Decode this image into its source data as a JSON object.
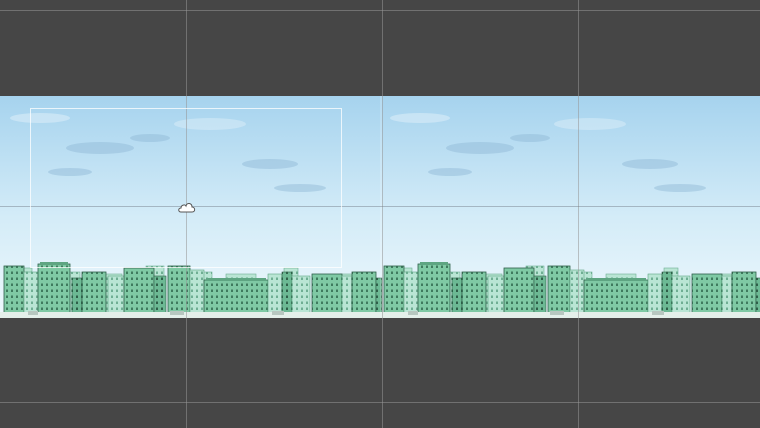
{
  "scene": {
    "name": "city-skyline-background",
    "tiles": 2,
    "colors": {
      "editor_bg": "#464646",
      "sky_top": "#a9d4ee",
      "sky_bottom": "#eaf6fb",
      "building_main": "#7fc9a4",
      "building_light": "#b4e2d0",
      "building_dark": "#5ea582",
      "window": "#3f7a5e",
      "outline": "#2f5f49",
      "ground": "#e6f0ec"
    }
  },
  "gizmos": {
    "pivot_icon": "cloud-pivot-icon",
    "camera_frame": "camera-bounds-frame"
  }
}
